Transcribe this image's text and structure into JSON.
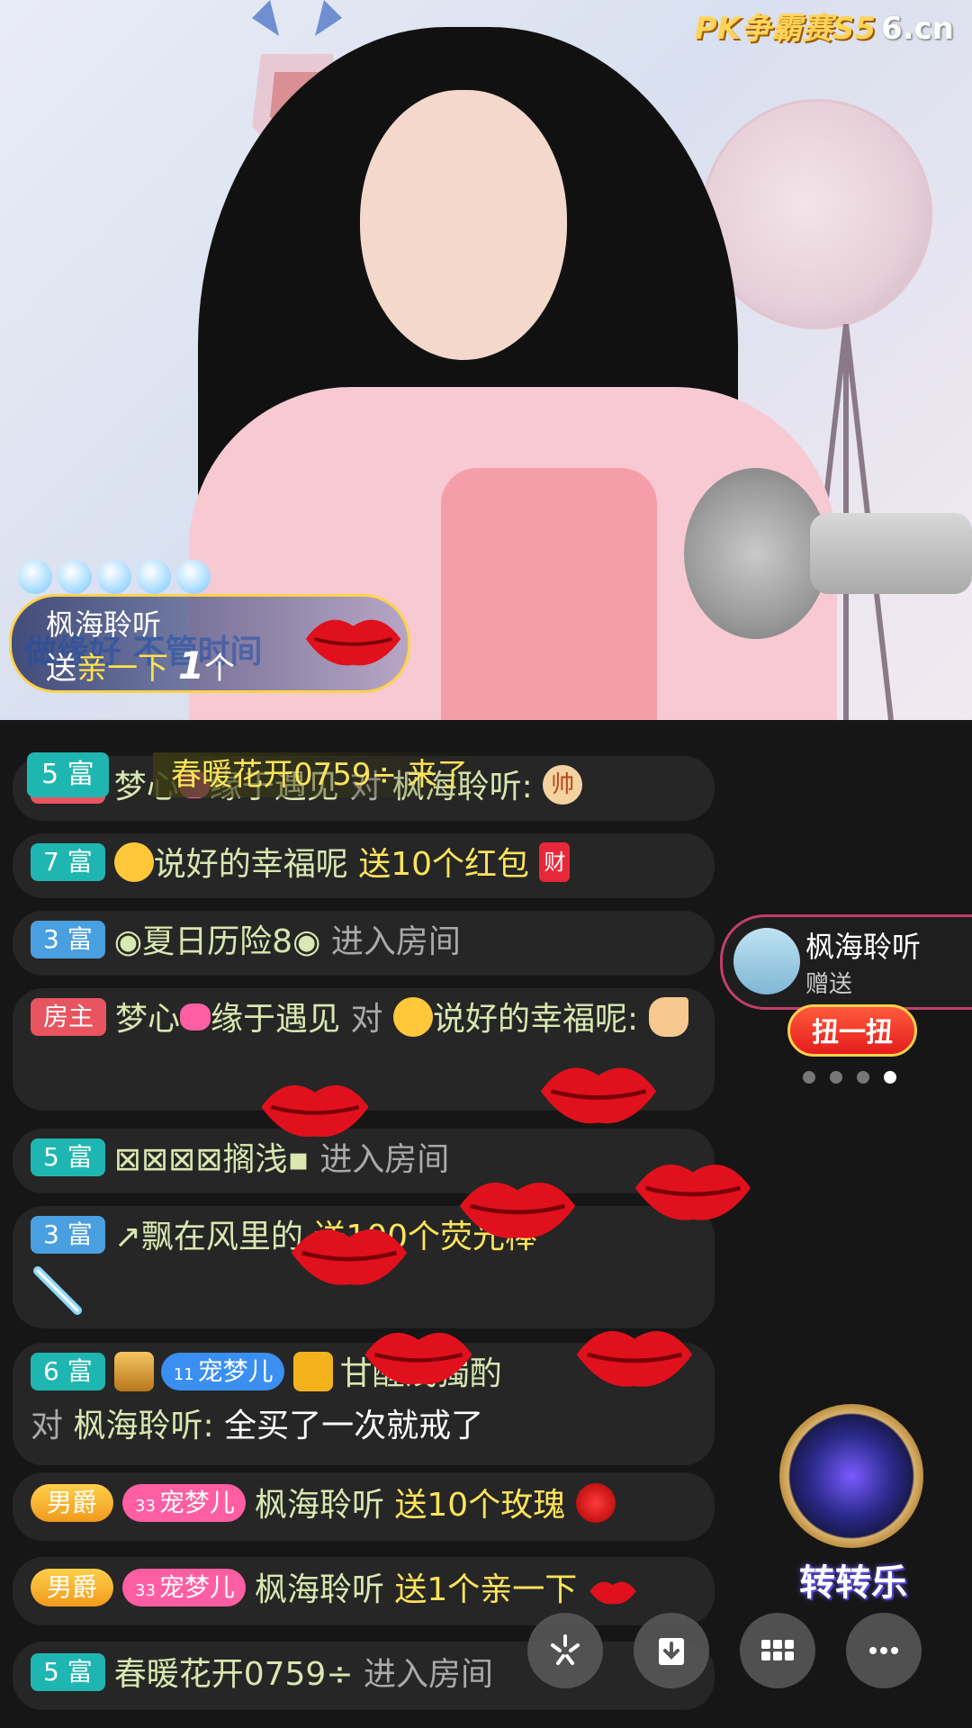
{
  "header": {
    "logo_event": "PK争霸赛S5",
    "logo_site": "6.cn"
  },
  "gift_banner": {
    "sender": "枫海聆听",
    "subtitle": "做缘好 不管时间",
    "verb": "送",
    "gift": "亲一下",
    "count": "1",
    "unit": "个"
  },
  "enter_banner": {
    "badge": "5 富",
    "text": "春暖花开0759÷ 来了"
  },
  "messages": [
    {
      "badge": "5 富",
      "prefix": "梦心",
      "middle": "缘于遇见",
      "to": "对",
      "target": "枫海聆听:",
      "icon": "帅"
    },
    {
      "badge": "7 富",
      "name": "说好的幸福呢",
      "gift": "送10个红包",
      "icon": "财"
    },
    {
      "badge": "3 富",
      "name": "◉夏日历险8◉",
      "action": "进入房间"
    },
    {
      "badge": "房主",
      "name": "梦心",
      "name2": "缘于遇见",
      "to": "对",
      "target": "说好的幸福呢:"
    },
    {
      "badge": "5 富",
      "name": "⊠⊠⊠⊠搁浅▪",
      "action": "进入房间"
    },
    {
      "badge": "3 富",
      "name": "↗飘在风里的",
      "gift": "送100个荧光棒"
    },
    {
      "badge": "6 富",
      "pet": "宠梦儿",
      "pet_level": "11",
      "name": "甘醒浅獨酌",
      "to": "对",
      "target": "枫海聆听:",
      "text": "全买了一次就戒了"
    },
    {
      "badge": "男爵",
      "pet": "宠梦儿",
      "pet_level": "33",
      "name": "枫海聆听",
      "gift": "送10个玫瑰"
    },
    {
      "badge": "男爵",
      "pet": "宠梦儿",
      "pet_level": "33",
      "name": "枫海聆听",
      "gift": "送1个亲一下"
    },
    {
      "badge": "5 富",
      "name": "春暖花开0759÷",
      "action": "进入房间"
    }
  ],
  "side_card": {
    "name": "枫海聆听",
    "sub": "赠送",
    "button": "扭一扭",
    "pages": 4,
    "active_page": 4
  },
  "wheel": {
    "label": "转转乐"
  },
  "toolbar": {
    "items": [
      "sparkle-icon",
      "download-icon",
      "grid-icon",
      "more-icon"
    ]
  },
  "colors": {
    "rich_badge": "#1fb6b1",
    "host_badge": "#e8545f",
    "gift_text": "#ffe45a",
    "name_text": "#d9e7b0"
  }
}
